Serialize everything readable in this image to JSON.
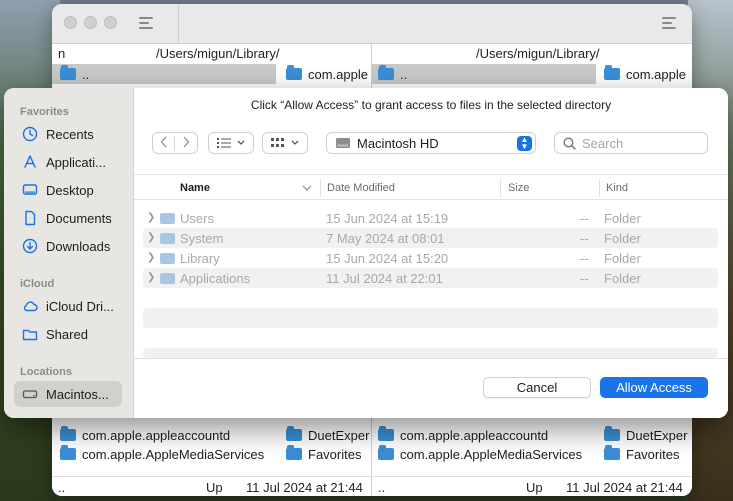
{
  "background_window": {
    "left_pane": {
      "column_n": "n",
      "path": "/Users/migun/Library/",
      "top_item": "..",
      "top_item_right": "com.apple",
      "bottom_items": [
        "com.apple.appleaccountd",
        "com.apple.AppleMediaServices"
      ],
      "bottom_items_right": [
        "DuetExper",
        "Favorites"
      ],
      "status_name": "..",
      "status_kind": "Up",
      "status_date": "11 Jul 2024 at 21:44"
    },
    "right_pane": {
      "path": "/Users/migun/Library/",
      "top_item": "..",
      "top_item_right": "com.apple",
      "bottom_items": [
        "com.apple.appleaccountd",
        "com.apple.AppleMediaServices"
      ],
      "bottom_items_right": [
        "DuetExper",
        "Favorites"
      ],
      "status_name": "..",
      "status_kind": "Up",
      "status_date": "11 Jul 2024 at 21:44"
    }
  },
  "dialog": {
    "prompt": "Click “Allow Access” to grant access to files in the selected directory",
    "sidebar": {
      "favorites_heading": "Favorites",
      "favorites": [
        {
          "label": "Recents",
          "icon": "clock-icon"
        },
        {
          "label": "Applicati...",
          "icon": "apps-icon"
        },
        {
          "label": "Desktop",
          "icon": "desktop-icon"
        },
        {
          "label": "Documents",
          "icon": "document-icon"
        },
        {
          "label": "Downloads",
          "icon": "download-icon"
        }
      ],
      "icloud_heading": "iCloud",
      "icloud": [
        {
          "label": "iCloud Dri...",
          "icon": "cloud-icon"
        },
        {
          "label": "Shared",
          "icon": "shared-folder-icon"
        }
      ],
      "locations_heading": "Locations",
      "locations": [
        {
          "label": "Macintos...",
          "icon": "disk-icon",
          "selected": true
        }
      ]
    },
    "location_popup": "Macintosh HD",
    "search_placeholder": "Search",
    "columns": {
      "name": "Name",
      "date": "Date Modified",
      "size": "Size",
      "kind": "Kind"
    },
    "rows": [
      {
        "name": "Users",
        "date": "15 Jun 2024 at 15:19",
        "size": "--",
        "kind": "Folder"
      },
      {
        "name": "System",
        "date": "7 May 2024 at 08:01",
        "size": "--",
        "kind": "Folder"
      },
      {
        "name": "Library",
        "date": "15 Jun 2024 at 15:20",
        "size": "--",
        "kind": "Folder"
      },
      {
        "name": "Applications",
        "date": "11 Jul 2024 at 22:01",
        "size": "--",
        "kind": "Folder"
      }
    ],
    "cancel_label": "Cancel",
    "allow_label": "Allow Access",
    "accent_color": "#1a73e8"
  }
}
